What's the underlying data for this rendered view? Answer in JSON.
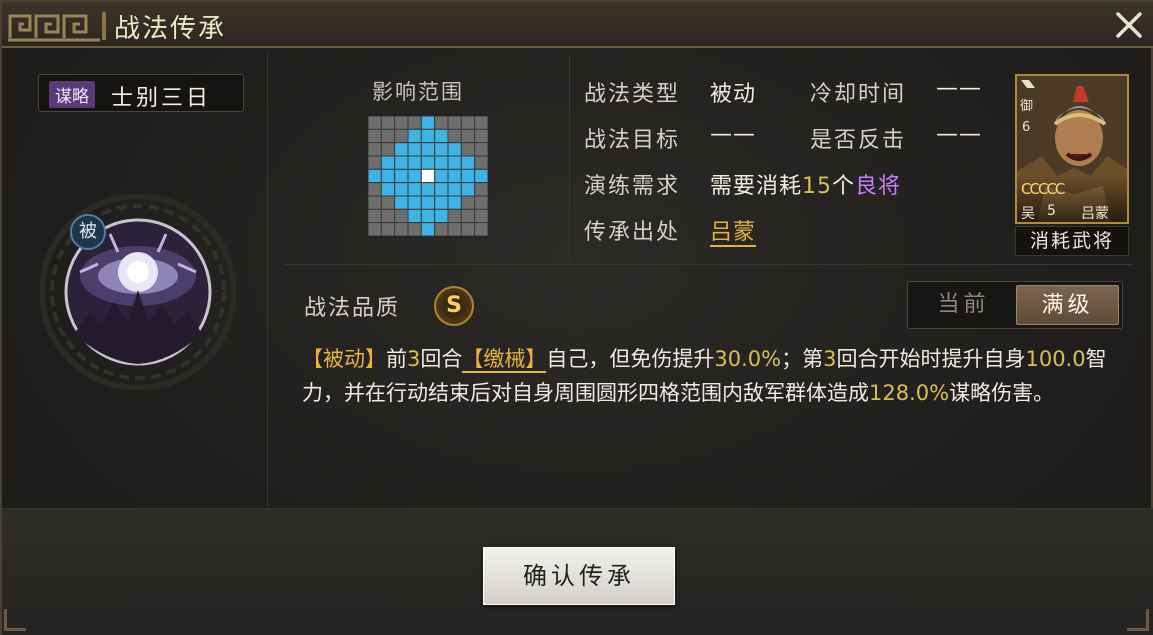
{
  "header": {
    "title": "战法传承"
  },
  "skill": {
    "type_tag": "谋略",
    "name": "士别三日",
    "passive_badge": "被"
  },
  "range": {
    "title": "影响范围",
    "grid_size": 9,
    "highlight_cells": [
      [
        0,
        4
      ],
      [
        1,
        3
      ],
      [
        1,
        4
      ],
      [
        1,
        5
      ],
      [
        2,
        2
      ],
      [
        2,
        3
      ],
      [
        2,
        4
      ],
      [
        2,
        5
      ],
      [
        2,
        6
      ],
      [
        3,
        1
      ],
      [
        3,
        2
      ],
      [
        3,
        3
      ],
      [
        3,
        4
      ],
      [
        3,
        5
      ],
      [
        3,
        6
      ],
      [
        3,
        7
      ],
      [
        4,
        0
      ],
      [
        4,
        1
      ],
      [
        4,
        2
      ],
      [
        4,
        3
      ],
      [
        4,
        5
      ],
      [
        4,
        6
      ],
      [
        4,
        7
      ],
      [
        4,
        8
      ],
      [
        5,
        1
      ],
      [
        5,
        2
      ],
      [
        5,
        3
      ],
      [
        5,
        4
      ],
      [
        5,
        5
      ],
      [
        5,
        6
      ],
      [
        5,
        7
      ],
      [
        6,
        2
      ],
      [
        6,
        3
      ],
      [
        6,
        4
      ],
      [
        6,
        5
      ],
      [
        6,
        6
      ],
      [
        7,
        3
      ],
      [
        7,
        4
      ],
      [
        7,
        5
      ],
      [
        8,
        4
      ]
    ],
    "center_cell": [
      4,
      4
    ],
    "colors": {
      "base": "#6e6e6e",
      "highlight": "#3db4e4",
      "center": "#ffffff",
      "line": "#3a3a3a"
    }
  },
  "info": {
    "type_label": "战法类型",
    "type_value": "被动",
    "cooldown_label": "冷却时间",
    "cooldown_value": "——",
    "target_label": "战法目标",
    "target_value": "——",
    "counter_label": "是否反击",
    "counter_value": "——",
    "req_label": "演练需求",
    "req_prefix": "需要消耗",
    "req_num": "15",
    "req_unit": "个",
    "req_quality": "良将",
    "source_label": "传承出处",
    "source_value": "吕蒙"
  },
  "general_card": {
    "arms": "御",
    "cost": "6",
    "stars": "CCCCC",
    "faction": "吴",
    "cost_bottom": "5",
    "name": "吕蒙",
    "caption": "消耗武将"
  },
  "quality": {
    "label": "战法品质",
    "grade": "S"
  },
  "tabs": {
    "current": "当前",
    "max": "满级"
  },
  "description": {
    "tag1": "【被动】",
    "t1": "前",
    "n1": "3",
    "t2": "回合",
    "tag2": "【缴械】",
    "t3": "自己，但免伤提升",
    "n2": "30.0%",
    "t4": "；第",
    "n3": "3",
    "t5": "回合开始时提升自身",
    "n4": "100.0",
    "t6": "智力，并在行动结束后对自身周围圆形四格范围内敌军群体造成",
    "n5": "128.0%",
    "t7": "谋略伤害。"
  },
  "footer": {
    "confirm": "确认传承"
  }
}
